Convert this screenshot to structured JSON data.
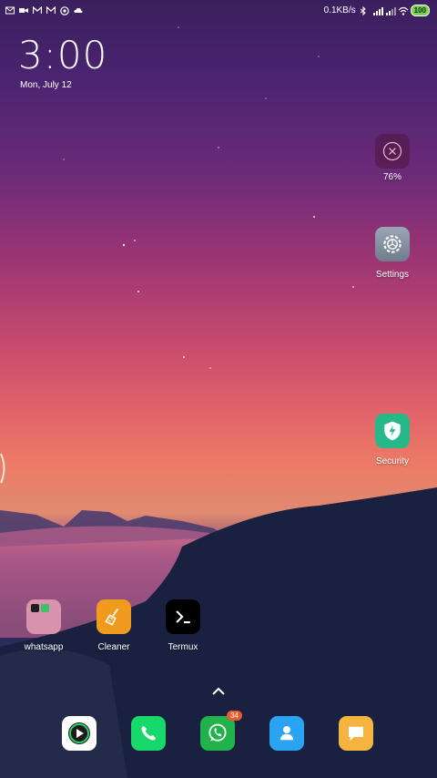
{
  "status_bar": {
    "notification_icons": [
      "gmail-icon",
      "video-icon",
      "gmail-icon",
      "gmail-icon",
      "whatsapp-icon",
      "cloud-icon"
    ],
    "network_speed": "0.1KB/s",
    "battery": "100"
  },
  "clock": {
    "time": "3:00",
    "date": "Mon, July 12"
  },
  "widgets": {
    "cleaner_widget": {
      "value": "76%"
    }
  },
  "apps": {
    "settings": {
      "label": "Settings"
    },
    "security": {
      "label": "Security"
    },
    "whatsapp_folder": {
      "label": "whatsapp"
    },
    "cleaner": {
      "label": "Cleaner"
    },
    "termux": {
      "label": "Termux"
    }
  },
  "dock": {
    "items": [
      {
        "name": "video-player",
        "badge": ""
      },
      {
        "name": "phone",
        "badge": ""
      },
      {
        "name": "whatsapp",
        "badge": "34"
      },
      {
        "name": "contacts",
        "badge": ""
      },
      {
        "name": "messages",
        "badge": ""
      }
    ]
  },
  "colors": {
    "security_bg": "#27b88a",
    "cleaner_bg": "#f09a1e",
    "phone_bg": "#19d86a",
    "whatsapp_bg": "#22b24c",
    "contacts_bg": "#2aa4f2",
    "messages_bg": "#f5b33f"
  }
}
